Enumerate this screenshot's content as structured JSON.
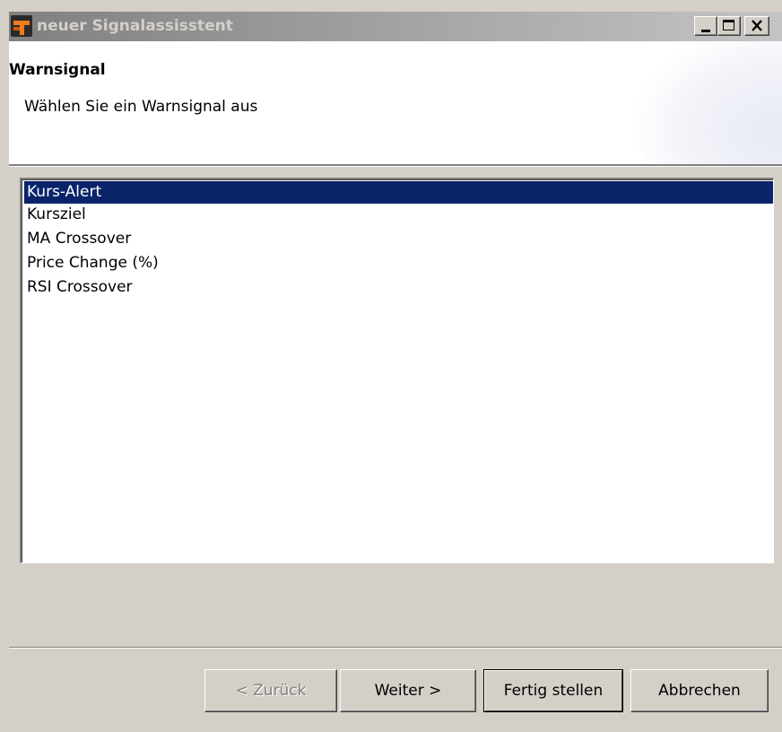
{
  "window": {
    "title": "neuer Signalassisstent",
    "app_icon": "app-logo-icon",
    "controls": [
      "minimize-icon",
      "maximize-icon",
      "close-icon"
    ]
  },
  "header": {
    "title": "Warnsignal",
    "subtitle": "Wählen Sie ein Warnsignal aus"
  },
  "signal_list": {
    "selected_index": 0,
    "items": [
      {
        "label": "Kurs-Alert"
      },
      {
        "label": "Kursziel"
      },
      {
        "label": "MA Crossover"
      },
      {
        "label": "Price Change (%)"
      },
      {
        "label": "RSI Crossover"
      }
    ]
  },
  "buttons": {
    "back_label": "< Zurück",
    "next_label": "Weiter >",
    "finish_label": "Fertig stellen",
    "cancel_label": "Abbrechen"
  },
  "colors": {
    "selection": "#0a246a",
    "dialog_bg": "#d4d0c8",
    "icon_accent": "#f07d1a"
  }
}
